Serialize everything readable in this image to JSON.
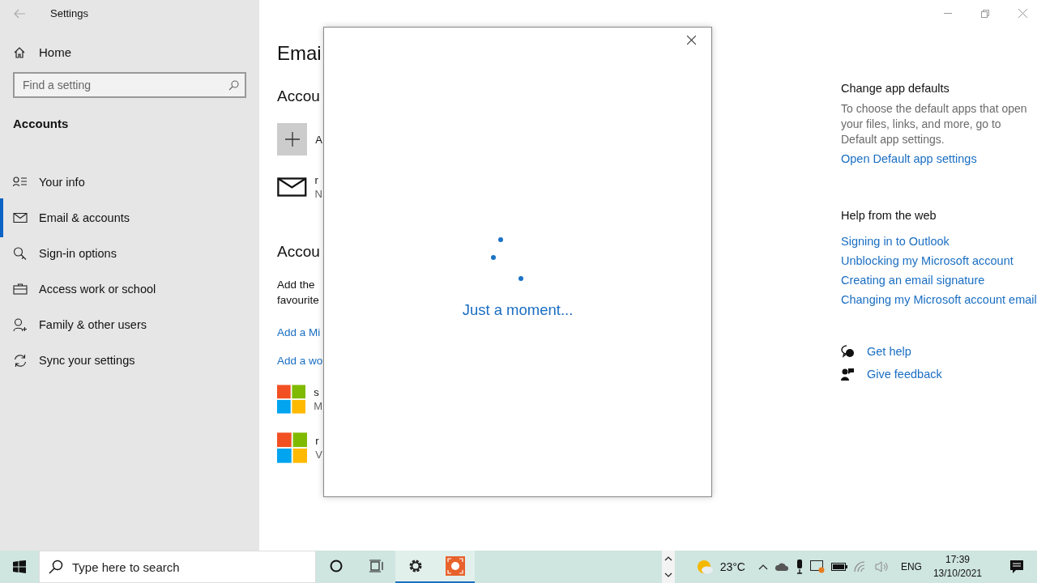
{
  "window": {
    "title": "Settings"
  },
  "sidebar": {
    "home": "Home",
    "search": {
      "placeholder": "Find a setting"
    },
    "section": "Accounts",
    "items": [
      {
        "label": "Your info",
        "selected": false
      },
      {
        "label": "Email & accounts",
        "selected": true
      },
      {
        "label": "Sign-in options",
        "selected": false
      },
      {
        "label": "Access work or school",
        "selected": false
      },
      {
        "label": "Family & other users",
        "selected": false
      },
      {
        "label": "Sync your settings",
        "selected": false
      }
    ]
  },
  "main": {
    "heading": "Emai",
    "section_1": "Accou",
    "accounts": [
      {
        "kind": "add",
        "line_1": "A"
      },
      {
        "kind": "mail",
        "line_1": "r",
        "line_2": "N"
      }
    ],
    "section_2": "Accou",
    "description": [
      "Add the",
      "favourite"
    ],
    "links": [
      "Add a Mi",
      "Add a wo"
    ],
    "other_accounts": [
      {
        "line_1": "s",
        "line_2": "M"
      },
      {
        "line_1": "r",
        "line_2": "V"
      }
    ]
  },
  "dialog": {
    "message": "Just a moment..."
  },
  "aside": {
    "defaults": {
      "title": "Change app defaults",
      "text": "To choose the default apps that open your files, links, and more, go to Default app settings.",
      "link": "Open Default app settings"
    },
    "help": {
      "title": "Help from the web",
      "links": [
        "Signing in to Outlook",
        "Unblocking my Microsoft account",
        "Creating an email signature",
        "Changing my Microsoft account email"
      ]
    },
    "support": [
      "Get help",
      "Give feedback"
    ]
  },
  "taskbar": {
    "search": {
      "placeholder": "Type here to search"
    },
    "apps": [
      {
        "active": false
      },
      {
        "active": false
      },
      {
        "active": true
      },
      {
        "active": true
      }
    ],
    "weather": "23°C",
    "language": "ENG",
    "time": "17:39",
    "date": "13/10/2021"
  }
}
